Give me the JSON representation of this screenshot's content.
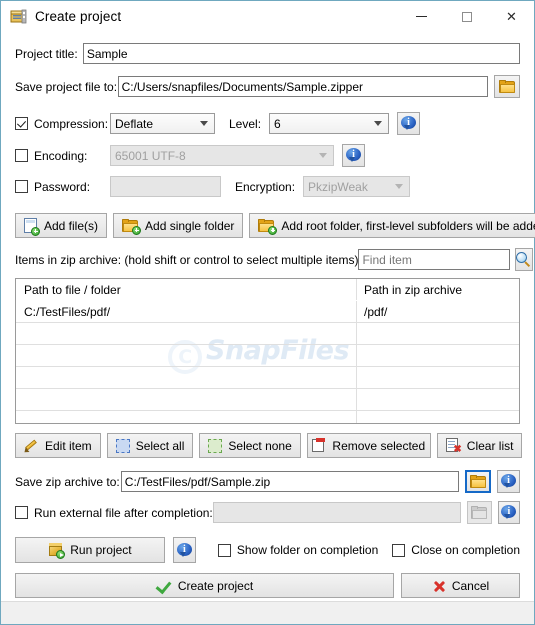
{
  "window": {
    "title": "Create project",
    "icon": "archive-icon",
    "minimize_label": "Minimize",
    "maximize_label": "Maximize",
    "close_label": "Close"
  },
  "project": {
    "title_label": "Project title:",
    "title_value": "Sample",
    "file_label": "Save project file to:",
    "file_value": "C:/Users/snapfiles/Documents/Sample.zipper",
    "browse_label": ""
  },
  "options": {
    "compression_label": "Compression:",
    "compression_checked": true,
    "compression_value": "Deflate",
    "level_label": "Level:",
    "level_value": "6",
    "encoding_label": "Encoding:",
    "encoding_checked": false,
    "encoding_value": "65001 UTF-8",
    "password_label": "Password:",
    "password_checked": false,
    "password_value": "",
    "encryption_label": "Encryption:",
    "encryption_value": "PkzipWeak"
  },
  "add_buttons": {
    "add_files": "Add file(s)",
    "add_single_folder": "Add single folder",
    "add_root_folder": "Add root folder, first-level subfolders will be added"
  },
  "items_section": {
    "label": "Items in zip archive: (hold shift or control to select multiple items)",
    "find_placeholder": "Find item",
    "find_value": "",
    "search_button": "Search"
  },
  "list": {
    "columns": [
      "Path to file / folder",
      "Path in zip archive"
    ],
    "rows": [
      {
        "path": "C:/TestFiles/pdf/",
        "zip_path": "/pdf/"
      }
    ],
    "empty_rows": 5,
    "watermark": "SnapFiles"
  },
  "list_buttons": {
    "edit_item": "Edit item",
    "select_all": "Select all",
    "select_none": "Select none",
    "remove_selected": "Remove selected",
    "clear_list": "Clear list"
  },
  "output": {
    "save_label": "Save zip archive to:",
    "save_value": "C:/TestFiles/pdf/Sample.zip",
    "run_external_label": "Run external file after completion:",
    "run_external_checked": false,
    "run_external_value": ""
  },
  "actions": {
    "run_project": "Run project",
    "show_folder_label": "Show folder on completion",
    "show_folder_checked": false,
    "close_on_completion_label": "Close on completion",
    "close_on_completion_checked": false,
    "create_project": "Create project",
    "cancel": "Cancel"
  },
  "colors": {
    "window_border": "#6fa8bf",
    "focus_blue": "#1569c7",
    "info_blue": "#2a62c4",
    "folder_yellow": "#e8b93f",
    "ok_green": "#3fa83f",
    "cancel_red": "#d8322b",
    "watermark": "#dfeaf5"
  }
}
